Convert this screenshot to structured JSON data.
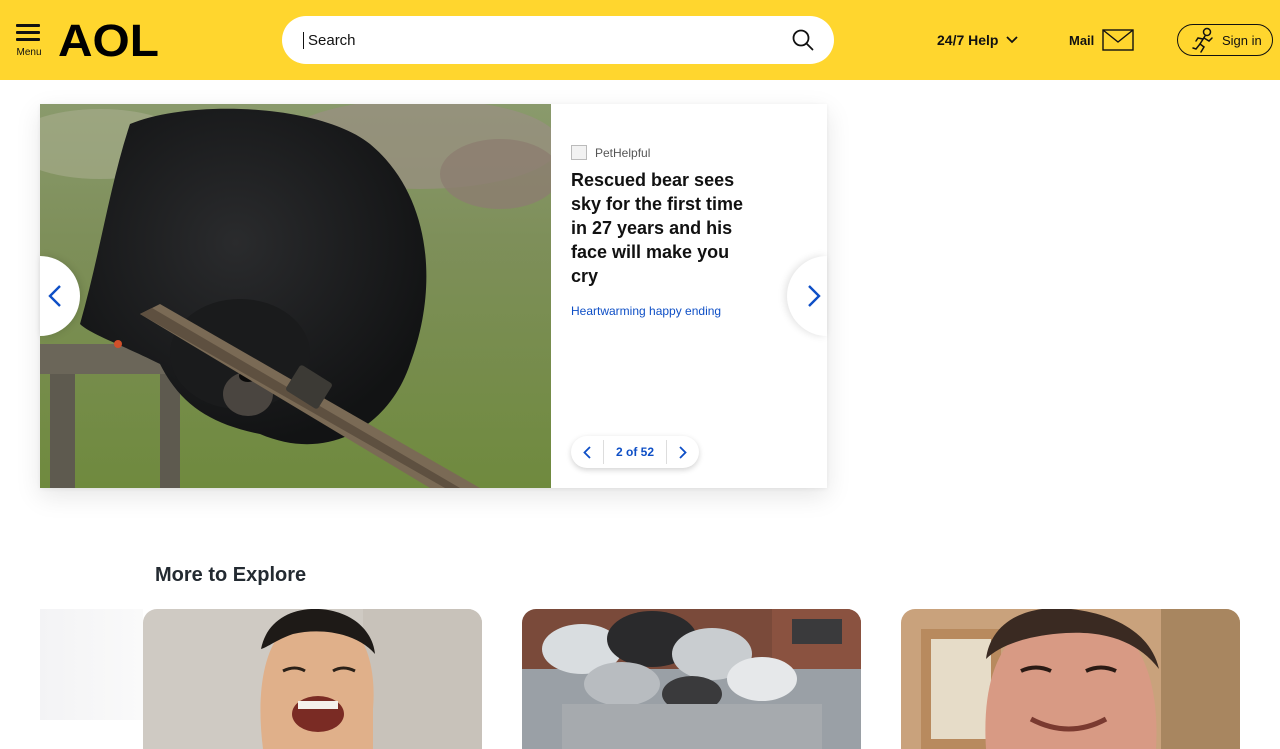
{
  "header": {
    "menu_label": "Menu",
    "logo_text": "AOL",
    "search_placeholder": "Search",
    "help_label": "24/7 Help",
    "mail_label": "Mail",
    "signin_label": "Sign in",
    "brand_color": "#ffd62e"
  },
  "carousel": {
    "source": "PetHelpful",
    "headline": "Rescued bear sees sky for the first time in 27 years and his face will make you cry",
    "tagline": "Heartwarming happy ending",
    "pager_text": "2 of 52",
    "accent_color": "#0e4fc6"
  },
  "explore": {
    "title": "More to Explore",
    "cards": [
      {
        "image": "laughing-man-photo"
      },
      {
        "image": "garbage-dumpster-photo"
      },
      {
        "image": "smiling-man-office-photo"
      }
    ]
  }
}
